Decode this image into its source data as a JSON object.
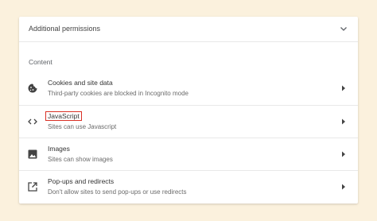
{
  "header": {
    "title": "Additional permissions",
    "chevron_icon": "chevron-down-icon"
  },
  "section": {
    "label": "Content"
  },
  "items": [
    {
      "title": "Cookies and site data",
      "subtitle": "Third-party cookies are blocked in Incognito mode",
      "icon": "cookie-icon"
    },
    {
      "title": "JavaScript",
      "subtitle": "Sites can use Javascript",
      "icon": "code-icon",
      "highlight_color": "#d93025"
    },
    {
      "title": "Images",
      "subtitle": "Sites can show images",
      "icon": "image-icon"
    },
    {
      "title": "Pop-ups and redirects",
      "subtitle": "Don't allow sites to send pop-ups or use redirects",
      "icon": "open-in-new-icon"
    }
  ],
  "colors": {
    "background": "#fbf1dd",
    "card": "#ffffff",
    "divider": "#e8e8e8",
    "text_primary": "#333333",
    "text_secondary": "#6b6b6b"
  }
}
